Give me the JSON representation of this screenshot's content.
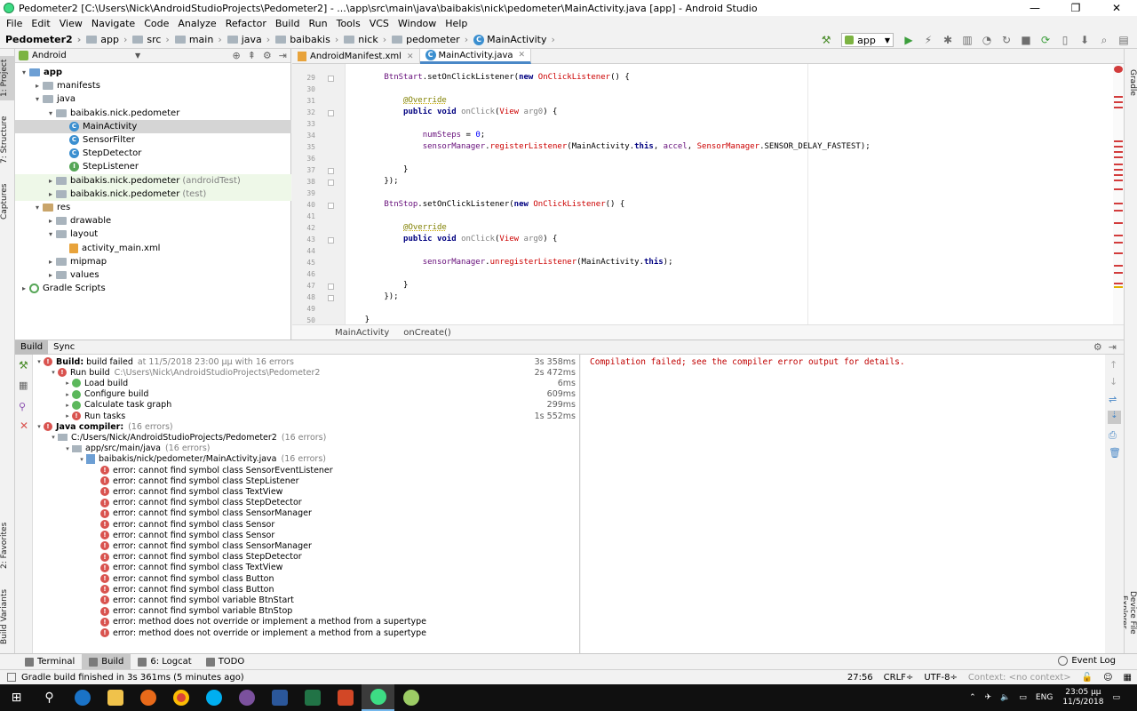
{
  "window": {
    "title": "Pedometer2 [C:\\Users\\Nick\\AndroidStudioProjects\\Pedometer2] - ...\\app\\src\\main\\java\\baibakis\\nick\\pedometer\\MainActivity.java [app] - Android Studio",
    "minimize": "—",
    "maximize": "❐",
    "close": "✕"
  },
  "menu": [
    "File",
    "Edit",
    "View",
    "Navigate",
    "Code",
    "Analyze",
    "Refactor",
    "Build",
    "Run",
    "Tools",
    "VCS",
    "Window",
    "Help"
  ],
  "breadcrumbs": [
    "Pedometer2",
    "app",
    "src",
    "main",
    "java",
    "baibakis",
    "nick",
    "pedometer",
    "MainActivity"
  ],
  "run_config": "app",
  "project_panel": {
    "view_label": "Android",
    "tree": [
      {
        "label": "app",
        "arrow": "▾",
        "icon": "folder-blue",
        "indent": 0,
        "bold": true
      },
      {
        "label": "manifests",
        "arrow": "▸",
        "icon": "folder-gray",
        "indent": 1
      },
      {
        "label": "java",
        "arrow": "▾",
        "icon": "folder-gray",
        "indent": 1
      },
      {
        "label": "baibakis.nick.pedometer",
        "arrow": "▾",
        "icon": "folder-gray",
        "indent": 2
      },
      {
        "label": "MainActivity",
        "arrow": "",
        "icon": "class",
        "indent": 3,
        "selected": true
      },
      {
        "label": "SensorFilter",
        "arrow": "",
        "icon": "class",
        "indent": 3
      },
      {
        "label": "StepDetector",
        "arrow": "",
        "icon": "class",
        "indent": 3
      },
      {
        "label": "StepListener",
        "arrow": "",
        "icon": "interface",
        "indent": 3
      },
      {
        "label": "baibakis.nick.pedometer",
        "suffix": "(androidTest)",
        "arrow": "▸",
        "icon": "folder-gray",
        "indent": 2,
        "test": true
      },
      {
        "label": "baibakis.nick.pedometer",
        "suffix": "(test)",
        "arrow": "▸",
        "icon": "folder-gray",
        "indent": 2,
        "test": true
      },
      {
        "label": "res",
        "arrow": "▾",
        "icon": "folder-res",
        "indent": 1
      },
      {
        "label": "drawable",
        "arrow": "▸",
        "icon": "folder-gray",
        "indent": 2
      },
      {
        "label": "layout",
        "arrow": "▾",
        "icon": "folder-gray",
        "indent": 2
      },
      {
        "label": "activity_main.xml",
        "arrow": "",
        "icon": "xml",
        "indent": 3
      },
      {
        "label": "mipmap",
        "arrow": "▸",
        "icon": "folder-gray",
        "indent": 2
      },
      {
        "label": "values",
        "arrow": "▸",
        "icon": "folder-gray",
        "indent": 2
      },
      {
        "label": "Gradle Scripts",
        "arrow": "▸",
        "icon": "gradle",
        "indent": 0
      }
    ]
  },
  "editor_tabs": [
    {
      "label": "AndroidManifest.xml",
      "active": false
    },
    {
      "label": "MainActivity.java",
      "active": true
    }
  ],
  "code_lines": [
    {
      "n": "29",
      "html": "        <span class='fld'>BtnStart</span>.setOnClickListener(<span class='kw'>new</span> <span class='err'>OnClickListener</span>() {"
    },
    {
      "n": "30",
      "html": ""
    },
    {
      "n": "31",
      "html": "            <span class='ann'>@Override</span>"
    },
    {
      "n": "32",
      "html": "            <span class='kw'>public void</span> <span class='param'>onClick</span>(<span class='err'>View</span> <span class='param'>arg0</span>) {"
    },
    {
      "n": "33",
      "html": ""
    },
    {
      "n": "34",
      "html": "                <span class='fld'>numSteps</span> = <span class='num'>0</span>;"
    },
    {
      "n": "35",
      "html": "                <span class='fld'>sensorManager</span>.<span class='err'>registerListener</span>(MainActivity.<span class='kw'>this</span>, <span class='fld'>accel</span>, <span class='err'>SensorManager</span>.SENSOR_DELAY_FASTEST);"
    },
    {
      "n": "36",
      "html": ""
    },
    {
      "n": "37",
      "html": "            }"
    },
    {
      "n": "38",
      "html": "        });"
    },
    {
      "n": "39",
      "html": ""
    },
    {
      "n": "40",
      "html": "        <span class='fld'>BtnStop</span>.setOnClickListener(<span class='kw'>new</span> <span class='err'>OnClickListener</span>() {"
    },
    {
      "n": "41",
      "html": ""
    },
    {
      "n": "42",
      "html": "            <span class='ann'>@Override</span>"
    },
    {
      "n": "43",
      "html": "            <span class='kw'>public void</span> <span class='param'>onClick</span>(<span class='err'>View</span> <span class='param'>arg0</span>) {"
    },
    {
      "n": "44",
      "html": ""
    },
    {
      "n": "45",
      "html": "                <span class='fld'>sensorManager</span>.<span class='err'>unregisterListener</span>(MainActivity.<span class='kw'>this</span>);"
    },
    {
      "n": "46",
      "html": ""
    },
    {
      "n": "47",
      "html": "            }"
    },
    {
      "n": "48",
      "html": "        });"
    },
    {
      "n": "49",
      "html": ""
    },
    {
      "n": "50",
      "html": "    }"
    }
  ],
  "editor_breadcrumb": [
    "MainActivity",
    "onCreate()"
  ],
  "build_tabs": [
    "Build",
    "Sync"
  ],
  "build_tree": [
    {
      "indent": 0,
      "arrow": "▾",
      "icon": "err",
      "html": "<b>Build:</b> build failed",
      "dim": "at 11/5/2018 23:00 μμ   with 16 errors",
      "time": "3s 358ms"
    },
    {
      "indent": 1,
      "arrow": "▾",
      "icon": "err",
      "html": "Run build",
      "dim": "C:\\Users\\Nick\\AndroidStudioProjects\\Pedometer2",
      "time": "2s 472ms"
    },
    {
      "indent": 2,
      "arrow": "▸",
      "icon": "ok",
      "html": "Load build",
      "dim": "",
      "time": "6ms"
    },
    {
      "indent": 2,
      "arrow": "▸",
      "icon": "ok",
      "html": "Configure build",
      "dim": "",
      "time": "609ms"
    },
    {
      "indent": 2,
      "arrow": "▸",
      "icon": "ok",
      "html": "Calculate task graph",
      "dim": "",
      "time": "299ms"
    },
    {
      "indent": 2,
      "arrow": "▸",
      "icon": "err",
      "html": "Run tasks",
      "dim": "",
      "time": "1s 552ms"
    },
    {
      "indent": 0,
      "arrow": "▾",
      "icon": "err",
      "html": "<b>Java compiler:</b>",
      "dim": "(16 errors)",
      "time": ""
    },
    {
      "indent": 1,
      "arrow": "▾",
      "icon": "fold",
      "html": "C:/Users/Nick/AndroidStudioProjects/Pedometer2",
      "dim": "(16 errors)",
      "time": ""
    },
    {
      "indent": 2,
      "arrow": "▾",
      "icon": "fold",
      "html": "app/src/main/java",
      "dim": "(16 errors)",
      "time": ""
    },
    {
      "indent": 3,
      "arrow": "▾",
      "icon": "file",
      "html": "baibakis/nick/pedometer/MainActivity.java",
      "dim": "(16 errors)",
      "time": ""
    },
    {
      "indent": 4,
      "arrow": "",
      "icon": "err",
      "html": "error: cannot find symbol class SensorEventListener",
      "dim": "",
      "time": ""
    },
    {
      "indent": 4,
      "arrow": "",
      "icon": "err",
      "html": "error: cannot find symbol class StepListener",
      "dim": "",
      "time": ""
    },
    {
      "indent": 4,
      "arrow": "",
      "icon": "err",
      "html": "error: cannot find symbol class TextView",
      "dim": "",
      "time": ""
    },
    {
      "indent": 4,
      "arrow": "",
      "icon": "err",
      "html": "error: cannot find symbol class StepDetector",
      "dim": "",
      "time": ""
    },
    {
      "indent": 4,
      "arrow": "",
      "icon": "err",
      "html": "error: cannot find symbol class SensorManager",
      "dim": "",
      "time": ""
    },
    {
      "indent": 4,
      "arrow": "",
      "icon": "err",
      "html": "error: cannot find symbol class Sensor",
      "dim": "",
      "time": ""
    },
    {
      "indent": 4,
      "arrow": "",
      "icon": "err",
      "html": "error: cannot find symbol class Sensor",
      "dim": "",
      "time": ""
    },
    {
      "indent": 4,
      "arrow": "",
      "icon": "err",
      "html": "error: cannot find symbol class SensorManager",
      "dim": "",
      "time": ""
    },
    {
      "indent": 4,
      "arrow": "",
      "icon": "err",
      "html": "error: cannot find symbol class StepDetector",
      "dim": "",
      "time": ""
    },
    {
      "indent": 4,
      "arrow": "",
      "icon": "err",
      "html": "error: cannot find symbol class TextView",
      "dim": "",
      "time": ""
    },
    {
      "indent": 4,
      "arrow": "",
      "icon": "err",
      "html": "error: cannot find symbol class Button",
      "dim": "",
      "time": ""
    },
    {
      "indent": 4,
      "arrow": "",
      "icon": "err",
      "html": "error: cannot find symbol class Button",
      "dim": "",
      "time": ""
    },
    {
      "indent": 4,
      "arrow": "",
      "icon": "err",
      "html": "error: cannot find symbol variable BtnStart",
      "dim": "",
      "time": ""
    },
    {
      "indent": 4,
      "arrow": "",
      "icon": "err",
      "html": "error: cannot find symbol variable BtnStop",
      "dim": "",
      "time": ""
    },
    {
      "indent": 4,
      "arrow": "",
      "icon": "err",
      "html": "error: method does not override or implement a method from a supertype",
      "dim": "",
      "time": ""
    },
    {
      "indent": 4,
      "arrow": "",
      "icon": "err",
      "html": "error: method does not override or implement a method from a supertype",
      "dim": "",
      "time": ""
    }
  ],
  "build_output": "Compilation failed; see the compiler error output for details.",
  "tool_tabs": [
    {
      "label": "Terminal",
      "active": false
    },
    {
      "label": "Build",
      "active": true
    },
    {
      "label": "6: Logcat",
      "active": false
    },
    {
      "label": "TODO",
      "active": false
    }
  ],
  "event_log": "Event Log",
  "left_strip_tabs": [
    "1: Project",
    "7: Structure",
    "Captures",
    "2: Favorites",
    "Build Variants"
  ],
  "right_strip_tabs": [
    "Gradle",
    "Device File Explorer"
  ],
  "status": {
    "message": "Gradle build finished in 3s 361ms (5 minutes ago)",
    "position": "27:56",
    "line_sep": "CRLF÷",
    "encoding": "UTF-8÷",
    "context": "Context: <no context>"
  },
  "taskbar": {
    "lang": "ENG",
    "time": "23:05 μμ",
    "date": "11/5/2018"
  },
  "colors": {
    "accent": "#4a88c7",
    "error": "#d9534f",
    "success": "#5cb85c"
  }
}
